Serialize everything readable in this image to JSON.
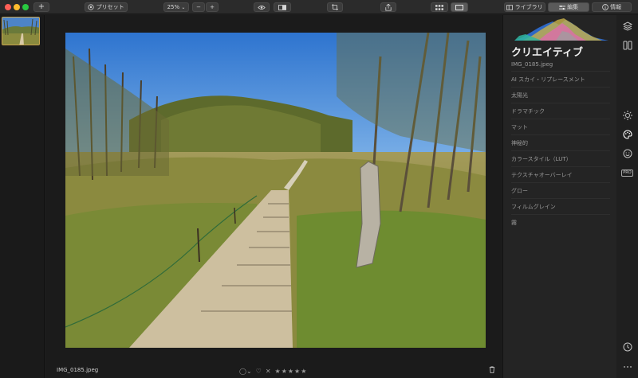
{
  "toolbar": {
    "add_button": "+",
    "presets_label": "プリセット",
    "zoom_value": "25%",
    "zoom_out": "−",
    "zoom_in": "+",
    "library_tab": "ライブラリ",
    "edit_tab": "編集",
    "info_tab": "情報"
  },
  "viewer": {
    "file_name": "IMG_0185.jpeg",
    "rating_reject": "✕",
    "rating_stars": "★★★★★",
    "rating": 0
  },
  "panel": {
    "title": "クリエイティブ",
    "file_name": "IMG_0185.jpeg",
    "tools": [
      "AI スカイ・リプレースメント",
      "太陽光",
      "ドラマチック",
      "マット",
      "神秘的",
      "カラースタイル（LUT）",
      "テクスチャオーバーレイ",
      "グロー",
      "フィルムグレイン",
      "霧"
    ]
  },
  "rail": {
    "pro_badge": "PRO"
  },
  "colors": {
    "accent_thumb_border": "#c9a34b",
    "panel_bg": "#242424",
    "toolbar_bg": "#2b2b2b"
  }
}
